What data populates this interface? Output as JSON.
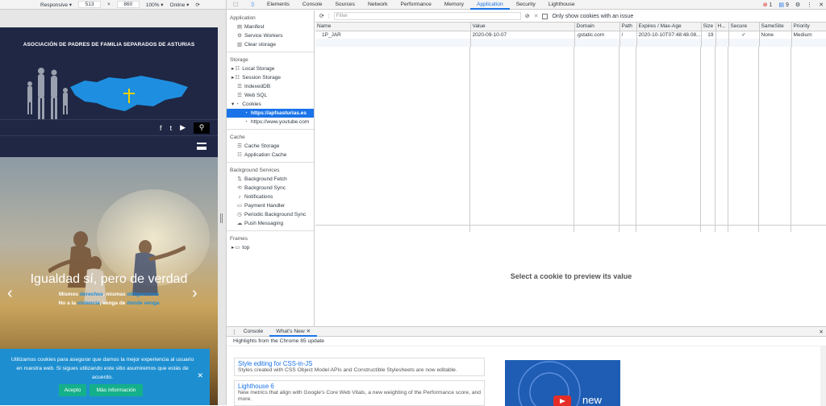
{
  "device_toolbar": {
    "mode": "Responsive",
    "width": "513",
    "times": "×",
    "height": "860",
    "zoom": "100%",
    "throttle": "Online"
  },
  "site": {
    "title": "ASOCIACIÓN DE PADRES DE FAMILIA SEPARADOS DE ASTURIAS",
    "social": {
      "facebook": "f",
      "twitter": "t",
      "youtube": "▶",
      "search": "⚲"
    },
    "hero": {
      "title": "Igualdad sí, pero de verdad",
      "line1_a": "Mismos ",
      "line1_b": "derechos",
      "line1_c": ", mismas ",
      "line1_d": "obligaciones",
      "line2_a": "No a la ",
      "line2_b": "violencia",
      "line2_c": ", venga de ",
      "line2_d": "donde venga"
    },
    "cookie": {
      "text": "Utilizamos cookies para asegurar que damos la mejor experiencia al usuario en nuestra web. Si sigues utilizando este sitio asumiremos que estás de acuerdo.",
      "accept": "Acepto",
      "more_info": "Más información",
      "close": "✕"
    }
  },
  "devtools": {
    "tabs": [
      "Elements",
      "Console",
      "Sources",
      "Network",
      "Performance",
      "Memory",
      "Application",
      "Security",
      "Lighthouse"
    ],
    "active_tab": "Application",
    "errors": "1",
    "warnings": "9",
    "sidebar": {
      "application_header": "Application",
      "manifest": "Manifest",
      "service_workers": "Service Workers",
      "clear_storage": "Clear storage",
      "storage_header": "Storage",
      "local_storage": "Local Storage",
      "session_storage": "Session Storage",
      "indexeddb": "IndexedDB",
      "web_sql": "Web SQL",
      "cookies": "Cookies",
      "cookie_site1": "https://apfsasturias.es",
      "cookie_site2": "https://www.youtube.com",
      "cache_header": "Cache",
      "cache_storage": "Cache Storage",
      "app_cache": "Application Cache",
      "bg_header": "Background Services",
      "bg_fetch": "Background Fetch",
      "bg_sync": "Background Sync",
      "notifications": "Notifications",
      "payment_handler": "Payment Handler",
      "periodic_sync": "Periodic Background Sync",
      "push": "Push Messaging",
      "frames_header": "Frames",
      "top": "top"
    },
    "toolbar": {
      "filter_placeholder": "Filter",
      "only_issues": "Only show cookies with an issue"
    },
    "table": {
      "headers": [
        "Name",
        "Value",
        "Domain",
        "Path",
        "Expires / Max-Age",
        "Size",
        "H...",
        "Secure",
        "SameSite",
        "Priority"
      ],
      "rows": [
        [
          "1P_JAR",
          "2020-09-10-07",
          ".gstatic.com",
          "/",
          "2020-10-10T07:48:48.08...",
          "19",
          "",
          "✓",
          "None",
          "Medium"
        ]
      ]
    },
    "preview_text": "Select a cookie to preview its value",
    "drawer": {
      "tabs": [
        "Console",
        "What's New"
      ],
      "close": "✕",
      "highlights": "Highlights from the Chrome 85 update",
      "card1_title": "Style editing for CSS-in-JS",
      "card1_desc": "Styles created with CSS Object Model APIs and Constructible Stylesheets are now editable.",
      "card2_title": "Lighthouse 6",
      "card2_desc": "New metrics that align with Google's Core Web Vitals, a new weighting of the Performance score, and more.",
      "video_label": "new"
    }
  }
}
